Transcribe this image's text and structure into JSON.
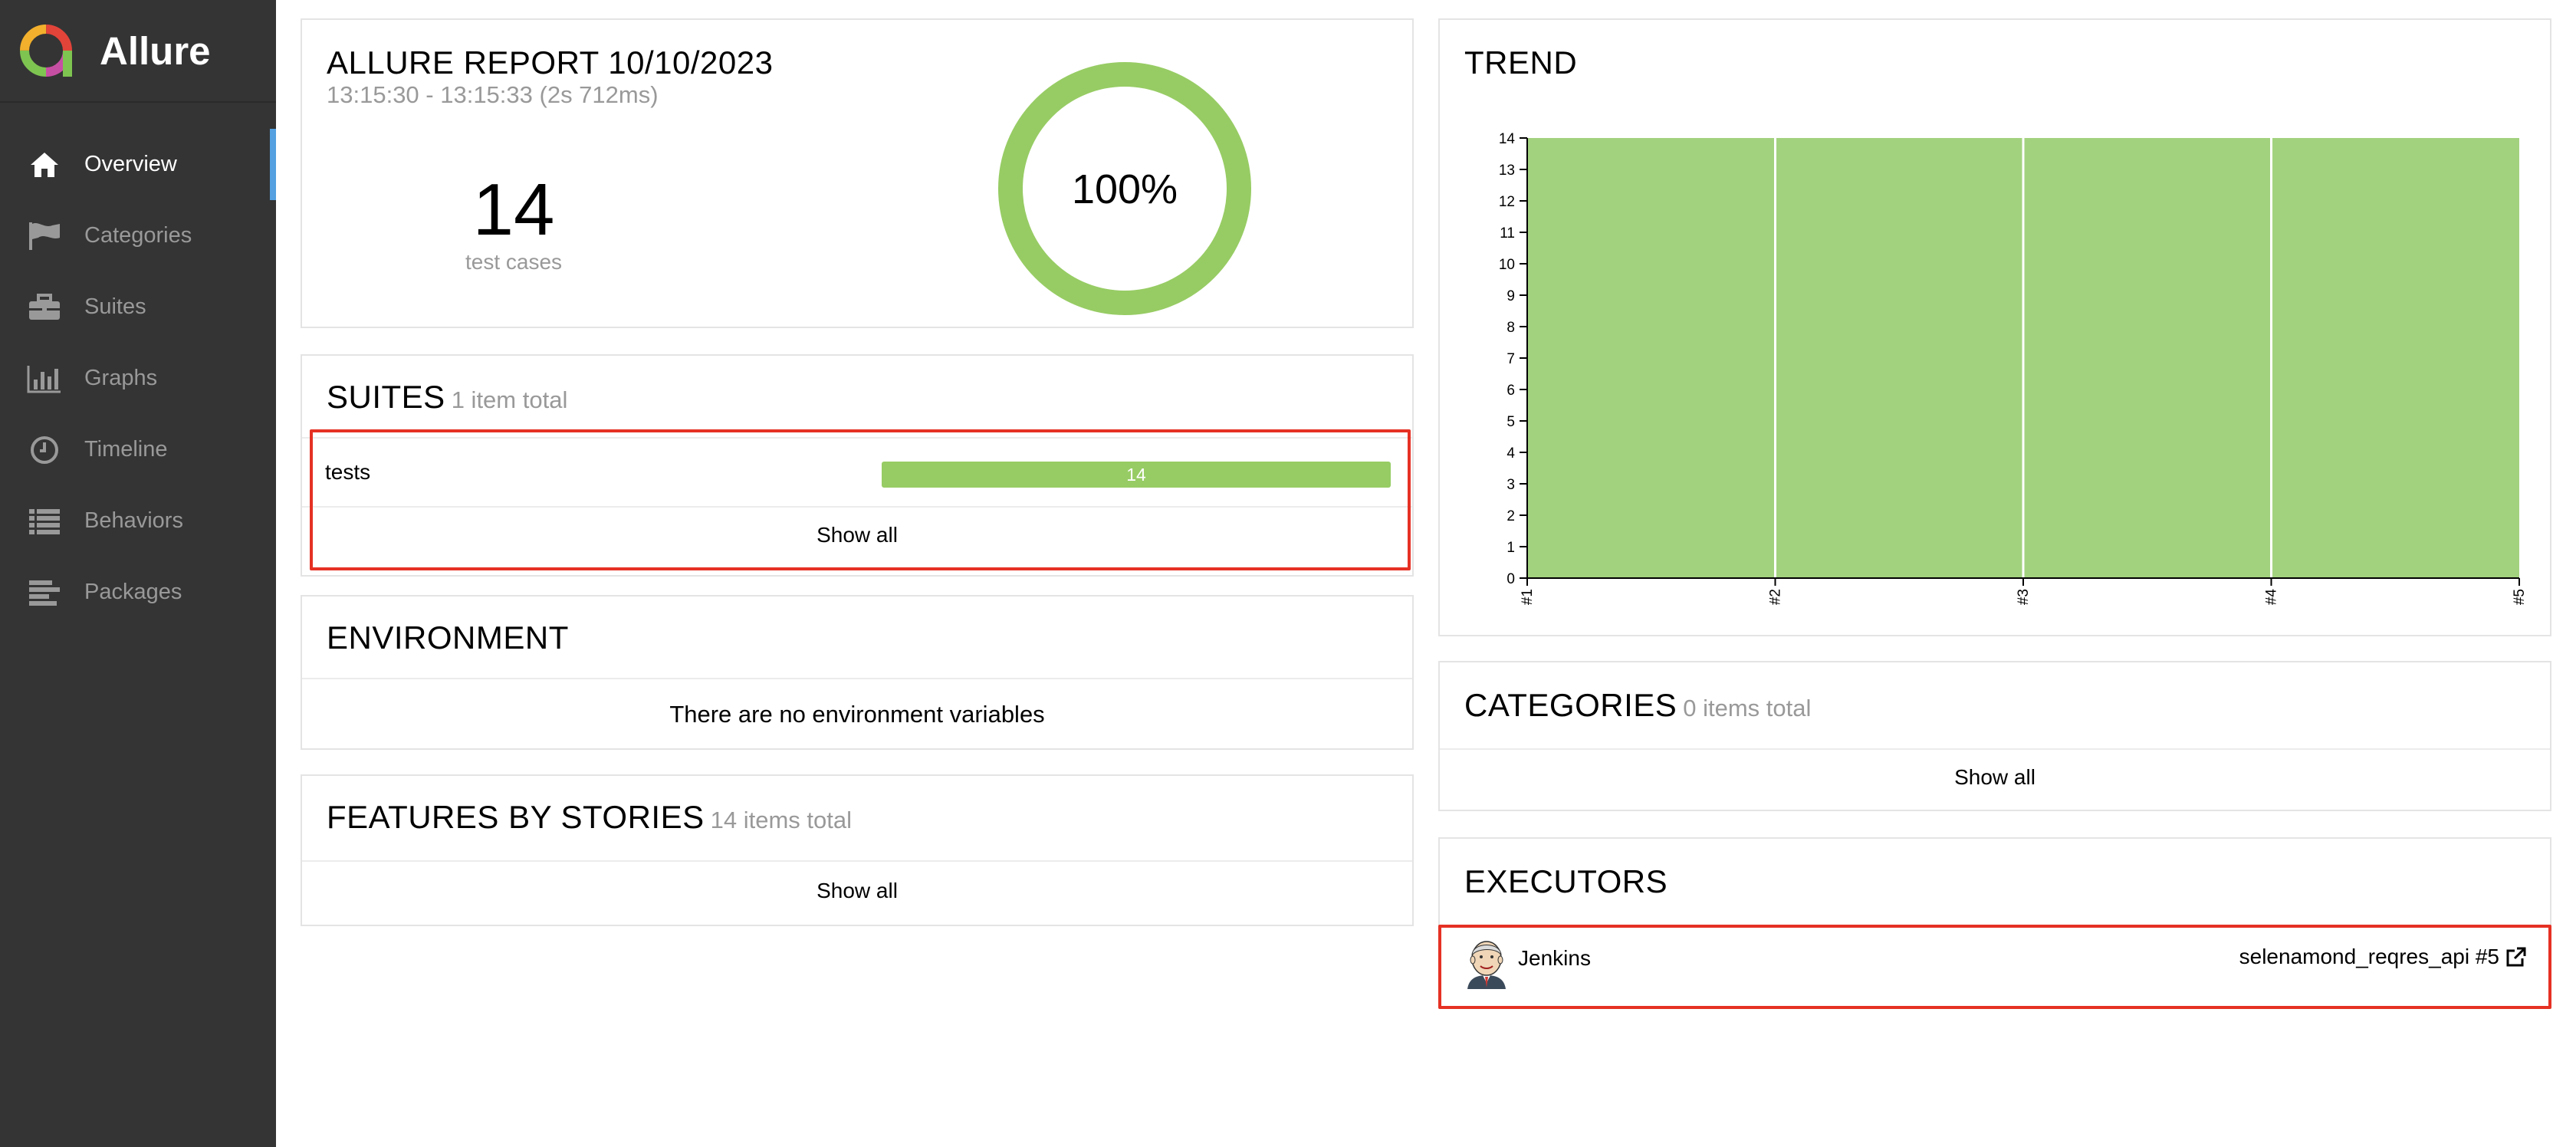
{
  "app": {
    "name": "Allure"
  },
  "sidebar": {
    "items": [
      {
        "label": "Overview",
        "icon": "home-icon",
        "active": true
      },
      {
        "label": "Categories",
        "icon": "flag-icon"
      },
      {
        "label": "Suites",
        "icon": "briefcase-icon"
      },
      {
        "label": "Graphs",
        "icon": "bar-chart-icon"
      },
      {
        "label": "Timeline",
        "icon": "clock-icon"
      },
      {
        "label": "Behaviors",
        "icon": "list-icon"
      },
      {
        "label": "Packages",
        "icon": "align-left-icon"
      }
    ]
  },
  "summary": {
    "title": "ALLURE REPORT 10/10/2023",
    "time_range": "13:15:30 - 13:15:33 (2s 712ms)",
    "test_count": "14",
    "test_count_label": "test cases",
    "success_rate": "100%",
    "success_fraction": 1.0
  },
  "suites": {
    "title": "SUITES",
    "subtitle": "1 item total",
    "rows": [
      {
        "name": "tests",
        "passed": "14"
      }
    ],
    "show_all": "Show all"
  },
  "environment": {
    "title": "ENVIRONMENT",
    "empty_text": "There are no environment variables"
  },
  "features": {
    "title": "FEATURES BY STORIES",
    "subtitle": "14 items total",
    "show_all": "Show all"
  },
  "trend": {
    "title": "TREND"
  },
  "categories": {
    "title": "CATEGORIES",
    "subtitle": "0 items total",
    "show_all": "Show all"
  },
  "executors": {
    "title": "EXECUTORS",
    "name": "Jenkins",
    "build": "selenamond_reqres_api #5"
  },
  "colors": {
    "passed": "#97cc64",
    "trend_fill": "#a3d27f",
    "sidebar": "#343434",
    "accent": "#54a0e0",
    "highlight": "#e53124"
  },
  "chart_data": {
    "type": "area",
    "x": [
      "#1",
      "#2",
      "#3",
      "#4",
      "#5"
    ],
    "series": [
      {
        "values": [
          14,
          14,
          14,
          14,
          14
        ]
      }
    ],
    "yticks": [
      "0",
      "1",
      "2",
      "3",
      "4",
      "5",
      "6",
      "7",
      "8",
      "9",
      "10",
      "11",
      "12",
      "13",
      "14"
    ],
    "ylim": [
      0,
      14
    ]
  }
}
